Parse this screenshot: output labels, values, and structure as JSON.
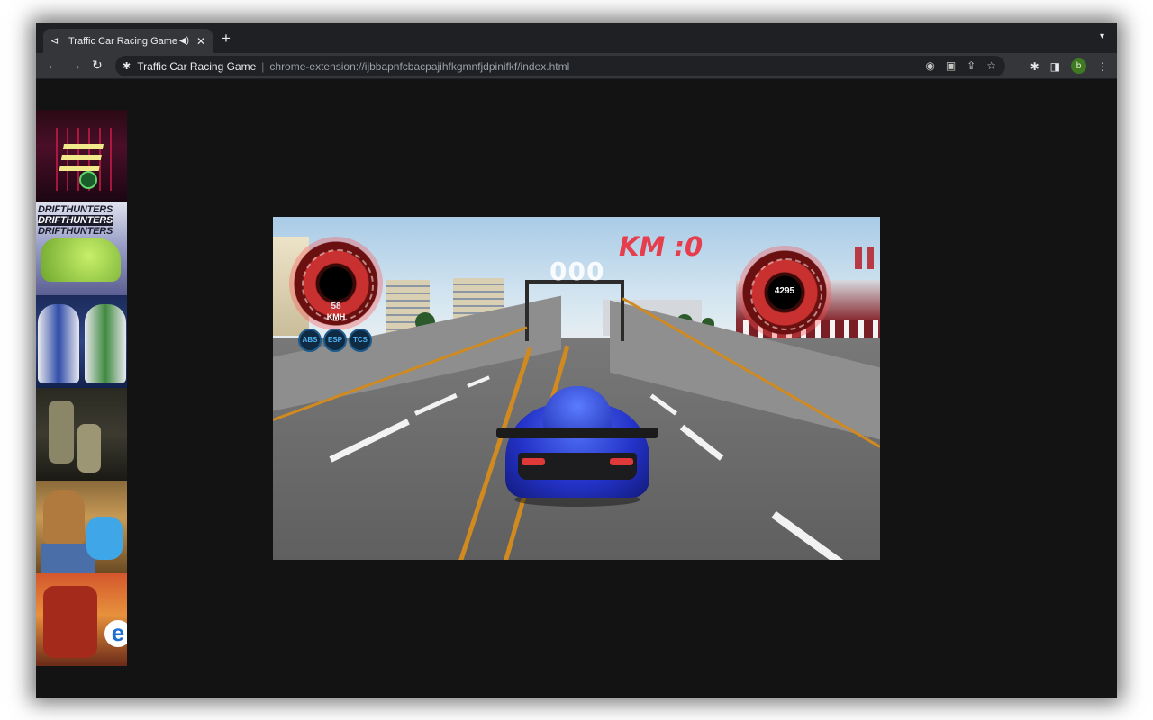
{
  "browser": {
    "tab_title": "Traffic Car Racing Game",
    "new_tab_symbol": "+",
    "page_title": "Traffic Car Racing Game",
    "url": "chrome-extension://ijbbapnfcbacpajihfkgmnfjdpinifkf/index.html",
    "profile_initial": "b"
  },
  "sidebar": {
    "thumbnails": [
      {
        "name": "neon-road-game",
        "text": ""
      },
      {
        "name": "drift-hunters",
        "text": "DRIFTHUNTERS"
      },
      {
        "name": "robot-fighters",
        "text": ""
      },
      {
        "name": "soldiers-game",
        "text": ""
      },
      {
        "name": "horse-character-game",
        "text": ""
      },
      {
        "name": "robot-shooter-game",
        "text": "e"
      }
    ]
  },
  "game": {
    "km_label": "KM :0",
    "gear_display": "000",
    "speed_value": "58",
    "speed_unit": "KMH",
    "rpm_value": "4295",
    "assist_buttons": [
      "ABS",
      "ESP",
      "TCS"
    ],
    "colors": {
      "km_red": "#e63e4c",
      "car_blue": "#2433c9",
      "assist_blue": "#4fb2f2"
    }
  }
}
